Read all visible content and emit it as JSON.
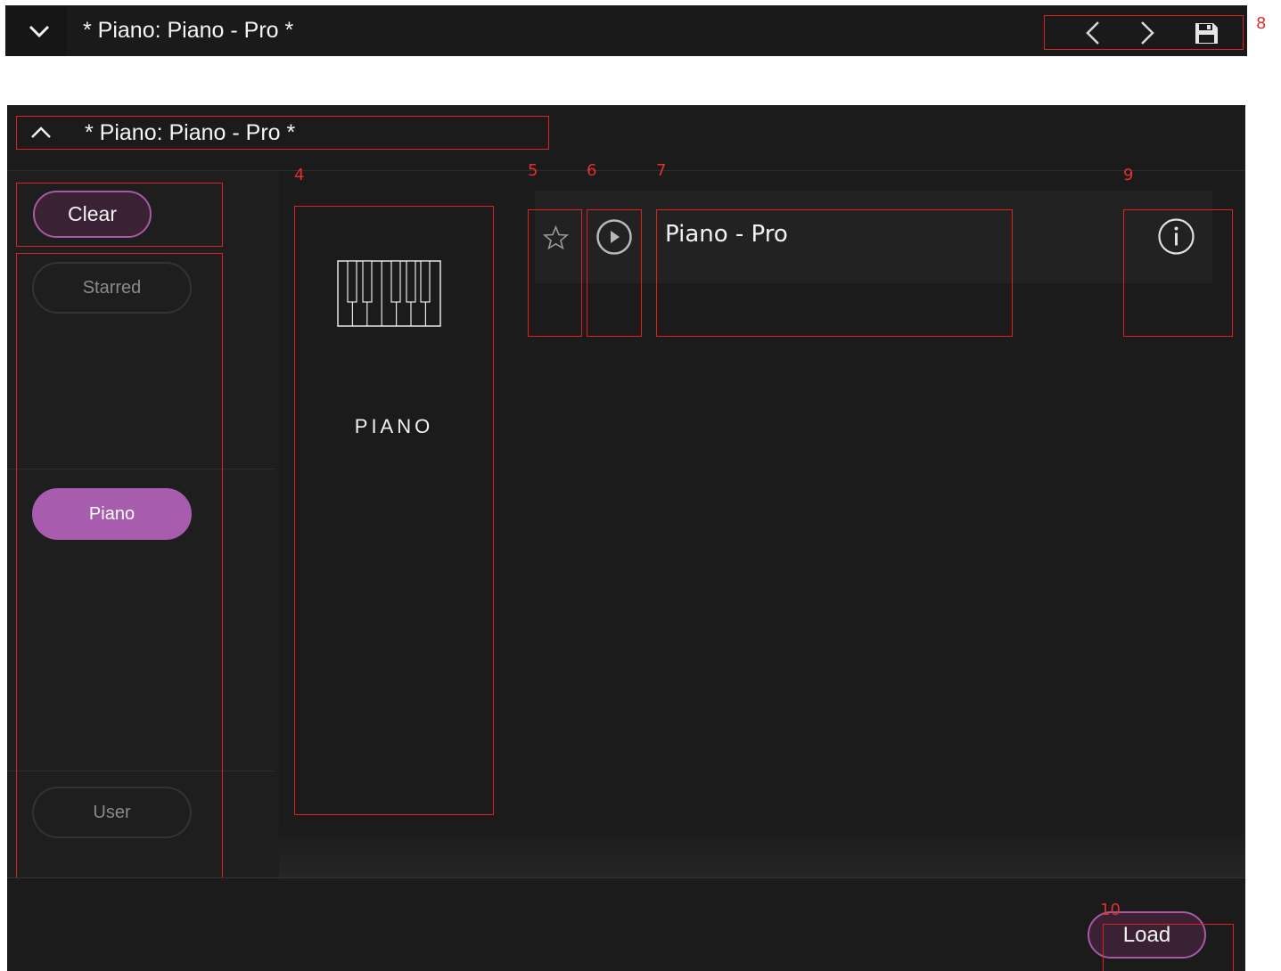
{
  "topbar": {
    "title": "* Piano: Piano - Pro *"
  },
  "panel": {
    "header_title": "* Piano: Piano - Pro *"
  },
  "sidebar": {
    "clear_label": "Clear",
    "filters": [
      {
        "label": "Starred",
        "active": false
      },
      {
        "label": "Piano",
        "active": true
      },
      {
        "label": "User",
        "active": false
      }
    ]
  },
  "category": {
    "label": "PIANO",
    "icon": "piano-keys-icon"
  },
  "preset": {
    "name": "Piano - Pro",
    "icons": [
      "star-icon",
      "play-icon",
      "info-icon"
    ]
  },
  "footer": {
    "load_label": "Load"
  },
  "annotations": {
    "a4": "4",
    "a5": "5",
    "a6": "6",
    "a7": "7",
    "a8": "8",
    "a9": "9",
    "a10": "10"
  },
  "colors": {
    "accent": "#a85cad",
    "accent_dark": "#3a2234",
    "background": "#1b1b1b",
    "annotation": "#dd2222"
  }
}
